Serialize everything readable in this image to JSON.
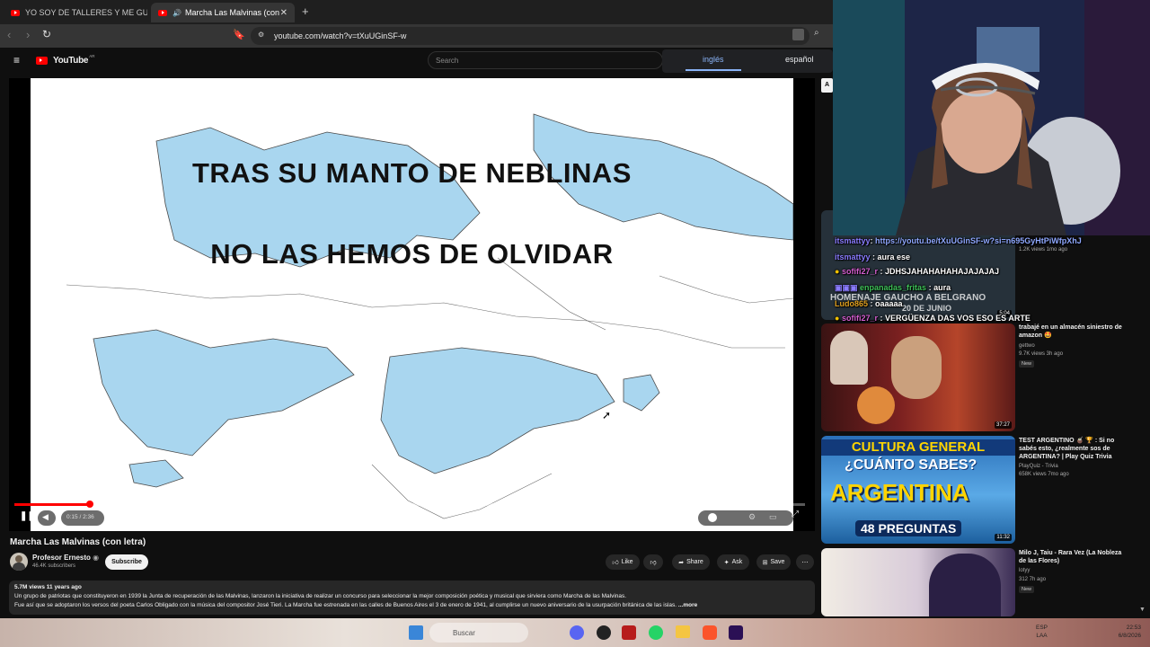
{
  "browser": {
    "tabs": [
      {
        "label": "YO SOY DE TALLERES Y ME GUSTA LA",
        "active": false
      },
      {
        "label": "Marcha Las Malvinas (con letr",
        "active": true
      }
    ],
    "url": "youtube.com/watch?v=tXuUGinSF-w"
  },
  "youtube": {
    "logo_text": "YouTube",
    "logo_region": "AR",
    "search_placeholder": "Search"
  },
  "translate_bar": {
    "tabs": [
      "inglés",
      "español"
    ],
    "active": "inglés"
  },
  "video": {
    "lyric_line_1": "TRAS SU MANTO DE NEBLINAS",
    "lyric_line_2": "NO LAS HEMOS DE OLVIDAR",
    "time": "0:15 / 2:36",
    "progress_fraction": 0.096,
    "title": "Marcha Las Malvinas (con letra)",
    "channel": "Profesor Ernesto",
    "subscribers": "46.4K subscribers",
    "subscribe_label": "Subscribe",
    "actions": {
      "like": "Like",
      "share": "Share",
      "ask": "Ask",
      "save": "Save"
    },
    "views_line": "5.7M views  11 years ago",
    "description_1": "Un grupo de patriotas que constituyeron en 1939 la Junta de recuperación de las Malvinas, lanzaron la iniciativa de realizar un concurso para seleccionar la mejor composición poética y musical que sirviera como Marcha de las Malvinas.",
    "description_2": "Fue así que se adoptaron los versos del poeta Carlos Obligado con la música del compositor José Tieri. La Marcha fue estrenada en las calles de Buenos Aires el 3 de enero de 1941, al cumplirse un nuevo aniversario de la usurpación británica de las islas.",
    "more_label": "...more"
  },
  "sidebar": {
    "top_item": {
      "thumb_text_1": "HOMENAJE GAUCHO A BELGRANO",
      "thumb_text_2": "20 DE JUNIO",
      "duration": "5:04",
      "meta": "1.2K views  1mo ago"
    },
    "items": [
      {
        "title": "trabajé en un almacén siniestro de amazon 🤩",
        "channel": "gettwo",
        "meta": "9.7K views  3h ago",
        "badge": "New",
        "duration": "37:27"
      },
      {
        "title": "TEST ARGENTINO 🧉 🏆 : Si no sabés esto, ¿realmente sos de ARGENTINA? | Play Quiz Trivia",
        "channel": "PlayQuiz - Trivia",
        "meta": "658K views  7mo ago",
        "badge": "",
        "duration": "11:32",
        "thumb_text_1": "CULTURA GENERAL",
        "thumb_text_2": "¿CUÁNTO SABES?",
        "thumb_text_3": "ARGENTINA",
        "thumb_text_4": "48 PREGUNTAS"
      },
      {
        "title": "Milo J, Taiu - Rara Vez (La Nobleza de las Flores)",
        "channel": "lotyy",
        "meta": "312  7h ago",
        "badge": "New",
        "duration": ""
      }
    ]
  },
  "chat": [
    {
      "user": "itsmattyy",
      "sep": ": ",
      "text": "https://youtu.be/tXuUGinSF-w?si=n695GyHtPiWfpXhJ",
      "user_color": "#8a7cff",
      "text_color": "#8fa8ff"
    },
    {
      "user": "itsmattyy",
      "sep": " : ",
      "text": "aura ese",
      "user_color": "#8a7cff",
      "text_color": "#ffffff"
    },
    {
      "user": "sofifi27_r",
      "sep": " : ",
      "text": "JDHSJAHAHAHAHAJAJAJAJ",
      "user_color": "#d45fd0",
      "text_color": "#ffffff"
    },
    {
      "user": "enpanadas_fritas",
      "sep": " : ",
      "text": "aura",
      "user_color": "#3fc25a",
      "text_color": "#ffffff"
    },
    {
      "user": "Ludo865",
      "sep": " : ",
      "text": "oaaaaa",
      "user_color": "#e0a020",
      "text_color": "#ffffff"
    },
    {
      "user": "sofifi27_r",
      "sep": " : ",
      "text": "VERGÜENZA DAS VOS ESO ES ARTE",
      "user_color": "#d45fd0",
      "text_color": "#ffffff"
    }
  ],
  "taskbar": {
    "search_placeholder": "Buscar",
    "lang": "ESP",
    "lang_region": "LAA",
    "time": "22:53",
    "date": "6/8/2026"
  },
  "colors": {
    "accent": "#ff0000",
    "translate_active": "#8ab4f8",
    "map_fill": "#a9d6ef"
  }
}
